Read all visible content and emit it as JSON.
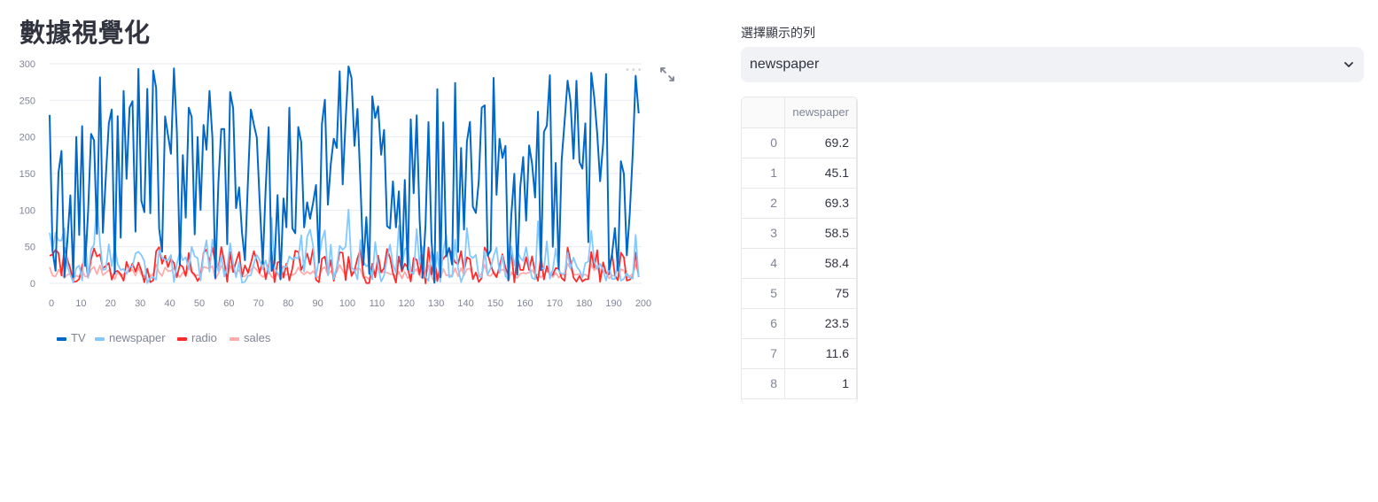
{
  "page": {
    "title": "數據視覺化"
  },
  "selector": {
    "label": "選擇顯示的列",
    "selected": "newspaper"
  },
  "table": {
    "column": "newspaper",
    "rows": [
      {
        "index": "0",
        "value": "69.2"
      },
      {
        "index": "1",
        "value": "45.1"
      },
      {
        "index": "2",
        "value": "69.3"
      },
      {
        "index": "3",
        "value": "58.5"
      },
      {
        "index": "4",
        "value": "58.4"
      },
      {
        "index": "5",
        "value": "75"
      },
      {
        "index": "6",
        "value": "23.5"
      },
      {
        "index": "7",
        "value": "11.6"
      },
      {
        "index": "8",
        "value": "1"
      }
    ]
  },
  "icons": {
    "expand": "expand-icon",
    "dropdown": "chevron-down-icon",
    "menu": "more-horizontal-icon"
  },
  "chart_data": {
    "type": "line",
    "title": "",
    "xlabel": "",
    "ylabel": "",
    "xlim": [
      0,
      200
    ],
    "ylim": [
      0,
      300
    ],
    "x_ticks": [
      0,
      10,
      20,
      30,
      40,
      50,
      60,
      70,
      80,
      90,
      100,
      110,
      120,
      130,
      140,
      150,
      160,
      170,
      180,
      190,
      200
    ],
    "y_ticks": [
      0,
      50,
      100,
      150,
      200,
      250,
      300
    ],
    "grid": true,
    "legend_position": "bottom-left",
    "series": [
      {
        "name": "TV",
        "color": "#0068C9",
        "values": [
          230.1,
          44.5,
          17.2,
          151.5,
          180.8,
          8.7,
          57.5,
          120.2,
          8.6,
          199.8,
          66.1,
          214.7,
          23.8,
          97.5,
          204.1,
          195.4,
          67.8,
          281.4,
          69.2,
          147.3,
          218.4,
          237.4,
          13.2,
          228.3,
          62.3,
          262.9,
          142.9,
          240.1,
          248.8,
          70.6,
          292.9,
          112.9,
          97.2,
          265.6,
          95.7,
          290.7,
          266.9,
          74.7,
          43.1,
          228.0,
          202.5,
          177.0,
          293.6,
          206.9,
          25.1,
          175.1,
          89.7,
          239.9,
          227.2,
          66.9,
          199.8,
          100.4,
          216.4,
          182.6,
          262.7,
          198.9,
          7.3,
          136.2,
          210.8,
          210.7,
          53.5,
          261.3,
          239.3,
          102.7,
          131.1,
          69.0,
          31.5,
          139.3,
          237.4,
          216.8,
          199.1,
          109.8,
          26.8,
          129.4,
          213.4,
          16.9,
          27.5,
          120.5,
          5.4,
          116.0,
          76.4,
          239.8,
          75.3,
          68.4,
          213.5,
          193.2,
          76.3,
          110.7,
          88.3,
          109.8,
          134.3,
          28.6,
          217.7,
          250.9,
          107.4,
          163.3,
          197.6,
          184.9,
          289.7,
          135.2,
          222.4,
          296.4,
          280.2,
          187.9,
          238.2,
          137.9,
          25.0,
          90.4,
          13.1,
          255.4,
          225.8,
          241.7,
          175.7,
          209.6,
          78.2,
          75.1,
          139.2,
          76.4,
          125.7,
          19.4,
          141.3,
          18.8,
          224.0,
          123.1,
          229.5,
          87.2,
          7.8,
          80.2,
          220.3,
          59.6,
          0.7,
          265.2,
          8.4,
          219.8,
          36.9,
          48.3,
          25.6,
          273.7,
          43.0,
          184.9,
          73.4,
          193.7,
          220.5,
          104.6,
          96.2,
          140.3,
          240.1,
          243.2,
          38.0,
          44.7,
          280.7,
          121.0,
          197.6,
          171.3,
          187.8,
          4.1,
          93.9,
          149.8,
          11.7,
          131.7,
          172.5,
          85.7,
          188.4,
          163.5,
          117.2,
          234.5,
          17.9,
          206.8,
          215.4,
          284.3,
          50.0,
          164.5,
          19.6,
          168.4,
          222.4,
          276.9,
          248.4,
          170.2,
          276.7,
          165.6,
          156.6,
          218.5,
          56.2,
          287.6,
          253.8,
          205.0,
          139.5,
          191.1,
          286.0,
          18.7,
          39.5,
          75.5,
          17.2,
          166.8,
          149.7,
          38.2,
          94.2,
          177.0,
          283.6,
          232.1
        ]
      },
      {
        "name": "newspaper",
        "color": "#83C9FF",
        "values": [
          69.2,
          45.1,
          69.3,
          58.5,
          58.4,
          75.0,
          23.5,
          11.6,
          1.0,
          21.2,
          24.2,
          4.0,
          65.9,
          7.2,
          46.0,
          52.9,
          114.0,
          55.8,
          18.3,
          19.1,
          53.4,
          23.5,
          49.6,
          26.2,
          18.3,
          19.5,
          12.6,
          22.9,
          22.9,
          40.8,
          43.2,
          38.6,
          30.0,
          0.3,
          7.4,
          8.5,
          5.0,
          45.7,
          35.1,
          32.0,
          31.6,
          38.7,
          1.8,
          26.4,
          43.3,
          31.5,
          35.7,
          18.5,
          49.9,
          36.8,
          34.6,
          3.6,
          39.6,
          58.7,
          15.9,
          60.0,
          41.4,
          16.6,
          37.7,
          9.3,
          21.4,
          54.7,
          27.3,
          8.4,
          28.9,
          0.9,
          2.2,
          10.2,
          11.0,
          27.2,
          38.7,
          31.7,
          19.3,
          31.3,
          13.1,
          89.4,
          20.7,
          14.2,
          9.4,
          23.1,
          22.3,
          36.9,
          32.5,
          35.6,
          33.8,
          65.7,
          16.0,
          63.2,
          73.4,
          51.4,
          9.3,
          33.0,
          59.0,
          72.3,
          10.9,
          52.9,
          5.9,
          22.0,
          51.2,
          45.9,
          49.8,
          100.9,
          21.4,
          17.9,
          5.3,
          59.0,
          29.7,
          23.2,
          25.6,
          5.5,
          56.5,
          23.2,
          2.4,
          10.7,
          34.5,
          52.7,
          25.6,
          14.8,
          79.2,
          22.3,
          46.2,
          50.4,
          15.6,
          12.4,
          74.2,
          25.9,
          50.6,
          9.2,
          3.2,
          43.1,
          8.7,
          43.0,
          2.1,
          45.1,
          65.6,
          8.5,
          9.3,
          59.7,
          20.5,
          1.7,
          12.9,
          75.6,
          37.9,
          34.4,
          38.9,
          9.0,
          8.7,
          44.3,
          11.9,
          20.6,
          37.0,
          48.7,
          14.2,
          37.7,
          9.5,
          5.7,
          50.5,
          24.3,
          45.2,
          34.6,
          30.7,
          49.3,
          25.6,
          7.4,
          5.4,
          84.8,
          21.6,
          19.4,
          57.6,
          6.4,
          18.4,
          47.4,
          17.0,
          12.8,
          13.1,
          41.8,
          20.3,
          35.2,
          23.7,
          17.6,
          8.3,
          27.4,
          29.7,
          71.8,
          30.0,
          19.6,
          26.6,
          18.2,
          3.7,
          23.4,
          5.8,
          6.0,
          31.6,
          3.6,
          6.0,
          13.8,
          8.1,
          6.4,
          66.2,
          8.7
        ]
      },
      {
        "name": "radio",
        "color": "#FF2B2B",
        "values": [
          37.8,
          39.3,
          45.9,
          41.3,
          10.8,
          48.9,
          32.8,
          19.6,
          2.1,
          2.6,
          5.8,
          24.0,
          35.1,
          7.6,
          32.9,
          47.7,
          36.6,
          39.6,
          20.5,
          23.9,
          27.7,
          5.1,
          15.9,
          16.9,
          12.6,
          3.5,
          29.3,
          16.7,
          27.1,
          16.0,
          28.3,
          17.4,
          1.5,
          20.0,
          1.4,
          4.1,
          43.8,
          49.4,
          26.7,
          37.7,
          22.3,
          33.4,
          27.7,
          8.4,
          25.7,
          22.5,
          9.9,
          41.5,
          15.8,
          11.7,
          3.1,
          9.6,
          41.7,
          46.2,
          28.8,
          49.4,
          28.1,
          19.2,
          49.6,
          29.5,
          2.0,
          42.7,
          15.5,
          29.6,
          42.8,
          9.3,
          24.6,
          14.5,
          27.5,
          43.9,
          30.6,
          14.3,
          33.0,
          5.7,
          24.6,
          43.7,
          1.6,
          28.5,
          29.9,
          7.7,
          26.7,
          4.1,
          20.3,
          44.5,
          43.0,
          18.4,
          27.5,
          40.6,
          25.5,
          47.8,
          4.9,
          1.5,
          33.5,
          36.5,
          14.0,
          31.6,
          3.5,
          21.0,
          42.3,
          41.7,
          4.3,
          36.3,
          10.1,
          17.2,
          34.3,
          46.4,
          11.0,
          0.3,
          0.4,
          26.9,
          8.2,
          38.0,
          15.4,
          20.6,
          46.8,
          35.0,
          14.3,
          0.8,
          36.9,
          16.0,
          26.8,
          21.7,
          2.4,
          34.6,
          32.3,
          11.8,
          38.9,
          0.0,
          49.0,
          12.0,
          39.6,
          2.9,
          27.2,
          33.5,
          38.6,
          47.0,
          39.0,
          28.9,
          25.9,
          43.9,
          17.0,
          35.4,
          33.2,
          5.7,
          14.8,
          1.9,
          7.3,
          49.0,
          40.3,
          25.8,
          13.9,
          8.4,
          23.3,
          39.7,
          21.1,
          11.6,
          43.5,
          1.3,
          36.9,
          18.4,
          18.1,
          35.8,
          18.1,
          36.8,
          14.7,
          3.4,
          37.6,
          5.2,
          23.6,
          10.6,
          11.6,
          20.9,
          20.1,
          7.1,
          3.4,
          48.9,
          30.2,
          7.8,
          2.3,
          10.0,
          2.6,
          5.4,
          5.7,
          43.0,
          21.3,
          45.1,
          2.1,
          28.7,
          13.9,
          12.1,
          41.1,
          10.8,
          4.1,
          42.0,
          35.6,
          3.7,
          4.9,
          9.3,
          42.0,
          8.6
        ]
      },
      {
        "name": "sales",
        "color": "#FFABAB",
        "values": [
          22.1,
          10.4,
          9.3,
          18.5,
          12.9,
          7.2,
          11.8,
          13.2,
          4.8,
          10.6,
          8.6,
          17.4,
          9.2,
          9.7,
          19.0,
          22.4,
          12.5,
          24.4,
          11.3,
          14.6,
          18.0,
          12.5,
          5.6,
          15.5,
          9.7,
          12.0,
          15.0,
          15.9,
          18.9,
          10.5,
          21.4,
          11.9,
          9.6,
          17.4,
          9.5,
          12.8,
          25.4,
          14.7,
          10.1,
          21.5,
          16.6,
          17.1,
          20.7,
          12.9,
          8.5,
          14.9,
          10.6,
          23.2,
          14.8,
          9.7,
          11.4,
          10.7,
          22.6,
          21.2,
          20.2,
          23.7,
          5.5,
          13.2,
          23.8,
          18.4,
          8.1,
          24.2,
          15.7,
          14.0,
          18.0,
          9.3,
          9.5,
          13.4,
          18.9,
          22.3,
          18.3,
          12.4,
          8.8,
          11.0,
          17.0,
          8.7,
          6.9,
          14.2,
          5.3,
          11.0,
          11.8,
          12.3,
          11.3,
          13.6,
          21.7,
          15.2,
          12.0,
          16.0,
          12.9,
          16.7,
          11.2,
          7.3,
          19.4,
          22.2,
          11.5,
          16.9,
          11.7,
          15.5,
          25.4,
          17.2,
          11.7,
          23.8,
          14.8,
          14.7,
          20.7,
          19.2,
          7.2,
          8.7,
          5.3,
          19.8,
          13.4,
          21.8,
          14.1,
          15.9,
          14.6,
          12.6,
          12.2,
          9.4,
          15.9,
          6.6,
          15.5,
          7.0,
          11.6,
          15.2,
          19.7,
          10.6,
          6.6,
          8.8,
          24.7,
          9.7,
          1.6,
          12.7,
          5.7,
          19.6,
          10.8,
          11.6,
          9.5,
          20.8,
          9.6,
          20.7,
          10.9,
          19.2,
          20.1,
          10.4,
          11.4,
          10.3,
          13.2,
          25.4,
          10.9,
          10.1,
          16.1,
          11.6,
          16.6,
          19.0,
          15.6,
          3.2,
          15.3,
          10.1,
          7.3,
          12.9,
          14.4,
          13.3,
          14.9,
          18.0,
          11.9,
          11.9,
          8.0,
          12.2,
          17.1,
          15.0,
          8.4,
          14.5,
          7.6,
          11.7,
          11.5,
          27.0,
          20.2,
          11.7,
          11.8,
          12.6,
          10.5,
          12.2,
          8.7,
          26.2,
          17.6,
          22.6,
          10.3,
          17.3,
          15.9,
          6.7,
          10.8,
          9.9,
          5.9,
          19.6,
          17.3,
          7.6,
          9.7,
          12.8,
          25.5,
          13.4
        ]
      }
    ]
  }
}
